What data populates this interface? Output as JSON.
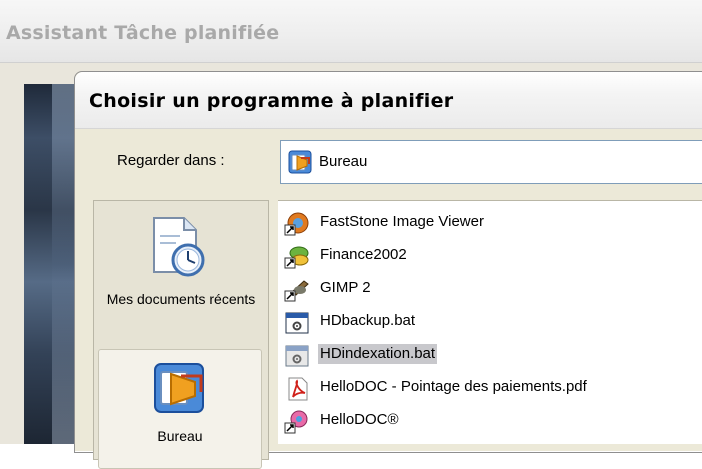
{
  "wizard": {
    "title": "Assistant Tâche planifiée"
  },
  "dialog": {
    "title": "Choisir un programme à planifier",
    "look_in_label": "Regarder dans :",
    "look_in_value": "Bureau"
  },
  "places": [
    {
      "label": "Mes documents récents",
      "icon": "recent-documents-icon"
    },
    {
      "label": "Bureau",
      "icon": "desktop-icon"
    }
  ],
  "files": [
    {
      "name": "FastStone Image Viewer",
      "icon": "faststone-shortcut-icon",
      "selected": false
    },
    {
      "name": "Finance2002",
      "icon": "finance-shortcut-icon",
      "selected": false
    },
    {
      "name": "GIMP 2",
      "icon": "gimp-shortcut-icon",
      "selected": false
    },
    {
      "name": "HDbackup.bat",
      "icon": "batch-file-icon",
      "selected": false
    },
    {
      "name": "HDindexation.bat",
      "icon": "batch-file-icon",
      "selected": true
    },
    {
      "name": "HelloDOC - Pointage des paiements.pdf",
      "icon": "pdf-file-icon",
      "selected": false
    },
    {
      "name": "HelloDOC®",
      "icon": "hellodoc-shortcut-icon",
      "selected": false
    }
  ]
}
